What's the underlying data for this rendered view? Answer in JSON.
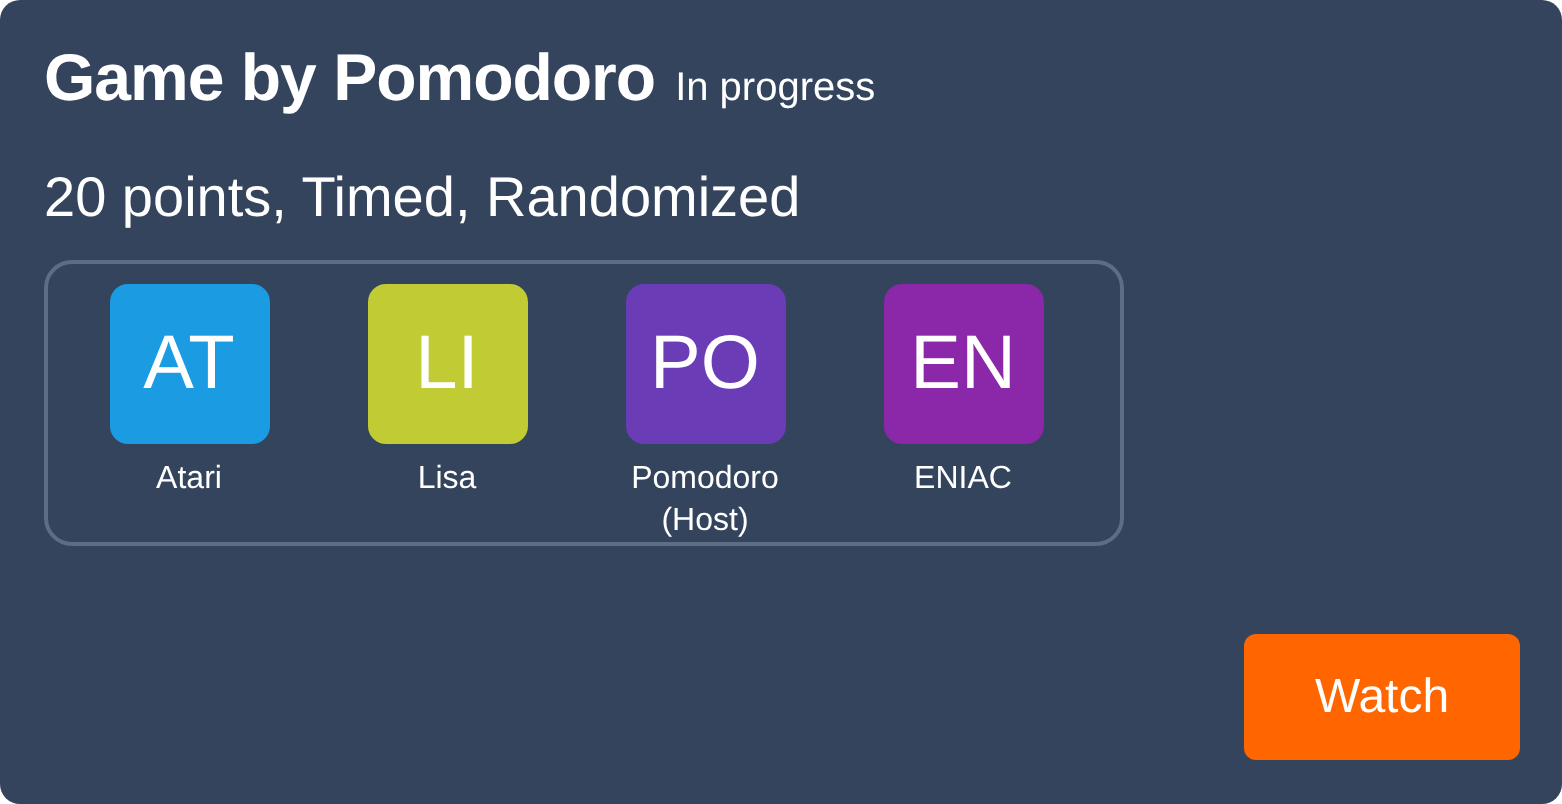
{
  "game": {
    "title": "Game by Pomodoro",
    "status": "In progress",
    "details": "20 points, Timed, Randomized"
  },
  "players": [
    {
      "initials": "AT",
      "name": "Atari",
      "color": "#1a9be2"
    },
    {
      "initials": "LI",
      "name": "Lisa",
      "color": "#c1cb33"
    },
    {
      "initials": "PO",
      "name": "Pomodoro (Host)",
      "color": "#6a3cb5"
    },
    {
      "initials": "EN",
      "name": "ENIAC",
      "color": "#8b27a9"
    }
  ],
  "action": {
    "label": "Watch"
  }
}
